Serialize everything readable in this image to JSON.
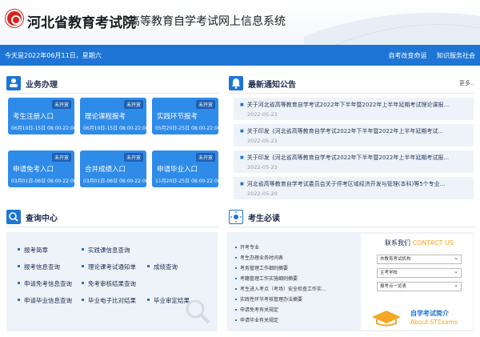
{
  "header": {
    "site_name": "河北省教育考试院",
    "subtitle": "高等教育自学考试网上信息系统"
  },
  "topbar": {
    "date": "今天是2022年06月11日，星期六",
    "links": [
      "自考改变命运",
      "知识服务社会"
    ]
  },
  "business": {
    "title": "业务办理",
    "tiles": [
      {
        "title": "考生注册入口",
        "badge": "未开放",
        "dates": "06月10日-15日 08:00-22:00"
      },
      {
        "title": "理论课程报考",
        "badge": "未开放",
        "dates": "06月10日-15日 08:00-22:00"
      },
      {
        "title": "实践环节报考",
        "badge": "未开放",
        "dates": "05月20日-25日 08:00-22:00"
      },
      {
        "title": "申请免考入口",
        "badge": "未开放",
        "dates": "03月01日-06日 08:00-22:00"
      },
      {
        "title": "合并成绩入口",
        "badge": "未开放",
        "dates": "03月01日-06日 08:00-22:00"
      },
      {
        "title": "申请毕业入口",
        "badge": "未开放",
        "dates": "11月20日-25日 08:00-22:00"
      }
    ]
  },
  "notices": {
    "title": "最新通知公告",
    "more": "更多..",
    "items": [
      {
        "text": "关于河北省高等教育自学考试2022年下半年暨2022年上半年延期考试理论课报...",
        "date": "2022-05-23"
      },
      {
        "text": "关于印发《河北省高等教育自学考试2022年下半年暨2022年上半年延期考试...",
        "date": "2022-05-23"
      },
      {
        "text": "关于印发《河北省高等教育自学考试2022年下半年暨2022年上半年延期考试报...",
        "date": "2022-05-23"
      },
      {
        "text": "河北省高等教育自学考试委员会关于停考区域经济开发与管理(本科)等5个专业...",
        "date": "2022-05-20"
      }
    ]
  },
  "query": {
    "title": "查询中心",
    "items": [
      "报考简章",
      "实践课信息查询",
      "报考信息查询",
      "理论课考试通知单",
      "成绩查询",
      "申请免考信息查询",
      "免考审核结果查询",
      "申请毕业信息查询",
      "毕业电子比对结果",
      "毕业审定结果"
    ]
  },
  "must": {
    "title": "考生必读",
    "items": [
      "开考专业",
      "考生办理业务时间表",
      "考务管理工作细则摘要",
      "考籍管理工作实施细则摘要",
      "考生进入考点（考场）安全检查工作实...",
      "实践性环节考核管理办法摘要",
      "申请免考有关规定",
      "申请毕业有关规定"
    ]
  },
  "contact": {
    "title": "联系我们",
    "title_en": "CONTACT US",
    "selects": [
      "市教育考试机构",
      "主考学校",
      "报考点一览表"
    ]
  },
  "about": {
    "title": "自学考试简介",
    "title_en": "About STExams"
  },
  "colors": {
    "primary": "#1e75d6",
    "tile": "#2f8be8",
    "accent": "#f5a623",
    "logo": "#d9211d"
  }
}
